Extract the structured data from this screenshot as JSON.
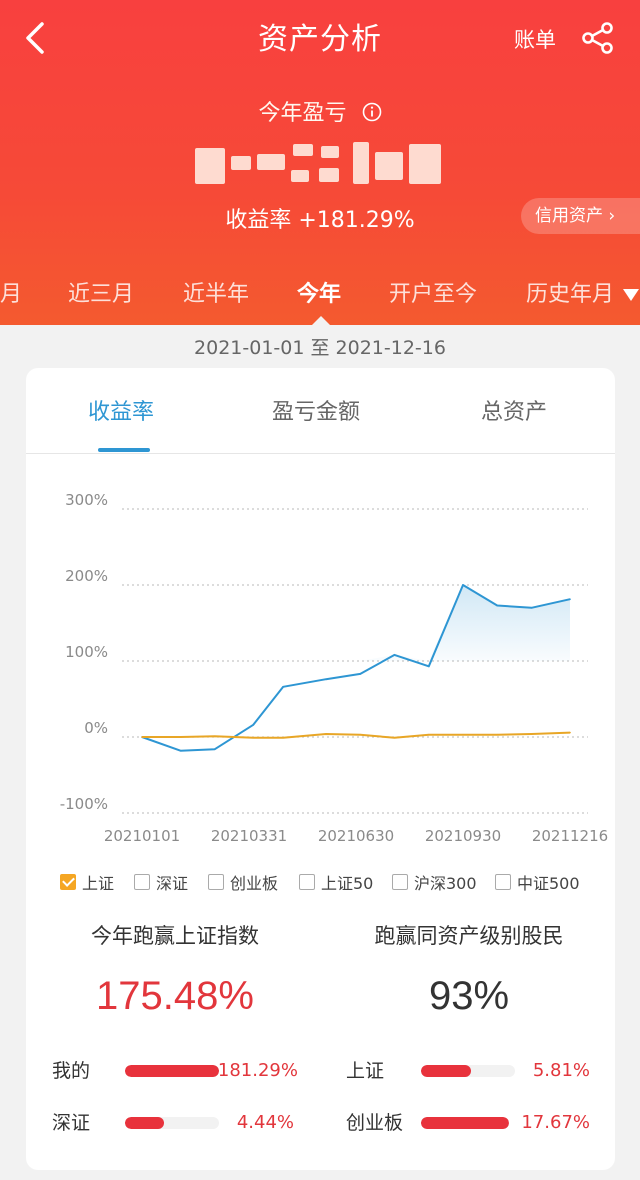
{
  "header": {
    "title": "资产分析",
    "bill_label": "账单",
    "pnl_label": "今年盈亏",
    "return_rate": "收益率 +181.29%",
    "credit_label": "信用资产 ›",
    "back_icon": "chevron-left-icon",
    "share_icon": "share-icon",
    "info_icon": "info-icon"
  },
  "period_tabs": [
    {
      "label": "月",
      "active": false
    },
    {
      "label": "近三月",
      "active": false
    },
    {
      "label": "近半年",
      "active": false
    },
    {
      "label": "今年",
      "active": true
    },
    {
      "label": "开户至今",
      "active": false
    },
    {
      "label": "历史年月",
      "active": false
    }
  ],
  "date_range": "2021-01-01 至 2021-12-16",
  "sub_tabs": [
    {
      "label": "收益率",
      "active": true
    },
    {
      "label": "盈亏金额",
      "active": false
    },
    {
      "label": "总资产",
      "active": false
    }
  ],
  "chart_data": {
    "type": "line",
    "y_ticks": [
      "300%",
      "200%",
      "100%",
      "0%",
      "-100%"
    ],
    "x_tick_labels": [
      "20210101",
      "20210331",
      "20210630",
      "20210930",
      "20211216"
    ],
    "ylim": [
      -100,
      300
    ],
    "grid": true,
    "series": [
      {
        "color": "#2e96d3",
        "fill": true,
        "points": [
          [
            0,
            0
          ],
          [
            0.09,
            -18
          ],
          [
            0.17,
            -16
          ],
          [
            0.26,
            16
          ],
          [
            0.33,
            66
          ],
          [
            0.43,
            76
          ],
          [
            0.51,
            83
          ],
          [
            0.59,
            108
          ],
          [
            0.67,
            93
          ],
          [
            0.75,
            200
          ],
          [
            0.83,
            173
          ],
          [
            0.91,
            170
          ],
          [
            1.0,
            181.29
          ]
        ]
      },
      {
        "name": "上证",
        "color": "#e8a626",
        "fill": false,
        "points": [
          [
            0,
            0
          ],
          [
            0.09,
            0
          ],
          [
            0.17,
            1
          ],
          [
            0.26,
            -1
          ],
          [
            0.33,
            -1
          ],
          [
            0.43,
            4
          ],
          [
            0.51,
            3
          ],
          [
            0.59,
            -1
          ],
          [
            0.67,
            3
          ],
          [
            0.75,
            3
          ],
          [
            0.83,
            3
          ],
          [
            0.91,
            4
          ],
          [
            1.0,
            5.81
          ]
        ]
      }
    ]
  },
  "legend": [
    {
      "label": "上证",
      "checked": true
    },
    {
      "label": "深证",
      "checked": false
    },
    {
      "label": "创业板",
      "checked": false
    },
    {
      "label": "上证50",
      "checked": false
    },
    {
      "label": "沪深300",
      "checked": false
    },
    {
      "label": "中证500",
      "checked": false
    }
  ],
  "stats": {
    "beat_index_title": "今年跑赢上证指数",
    "beat_index_value": "175.48%",
    "beat_peers_title": "跑赢同资产级别股民",
    "beat_peers_value": "93%"
  },
  "comparison": [
    {
      "label": "我的",
      "value": "181.29%",
      "fraction": 1.0
    },
    {
      "label": "上证",
      "value": "5.81%",
      "fraction": 0.53
    },
    {
      "label": "深证",
      "value": "4.44%",
      "fraction": 0.41
    },
    {
      "label": "创业板",
      "value": "17.67%",
      "fraction": 1.0
    }
  ],
  "colors": {
    "header_red": "#f8403f",
    "accent_blue": "#2e96d3",
    "index_gold": "#e8a626",
    "value_red": "#e2363c"
  }
}
